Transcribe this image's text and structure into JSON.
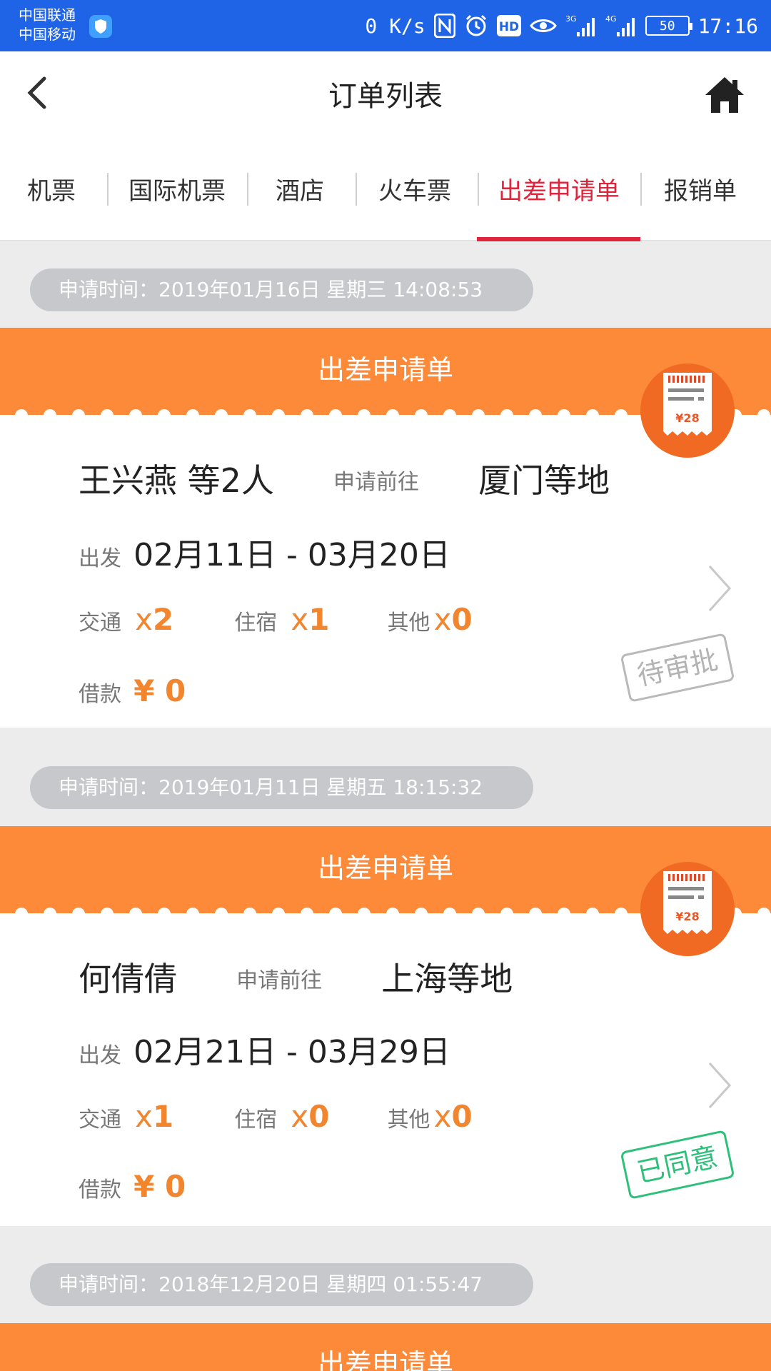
{
  "status_bar": {
    "carrier_1": "中国联通",
    "carrier_2": "中国移动",
    "net_speed": "0 K/s",
    "network_1": "3G",
    "network_2": "4G",
    "battery": "50",
    "time": "17:16"
  },
  "header": {
    "title": "订单列表",
    "back_icon": "chevron-left-icon",
    "home_icon": "home-icon"
  },
  "tabs": [
    {
      "label": "机票",
      "active": false
    },
    {
      "label": "国际机票",
      "active": false
    },
    {
      "label": "酒店",
      "active": false
    },
    {
      "label": "火车票",
      "active": false
    },
    {
      "label": "出差申请单",
      "active": true
    },
    {
      "label": "报销单",
      "active": false
    }
  ],
  "colors": {
    "accent": "#e0243b",
    "banner": "#fd8a38",
    "count": "#f2862f",
    "status_blue": "#1f63e6",
    "approved_green": "#2ec07a"
  },
  "orders": [
    {
      "apply_time": "申请时间：2019年01月16日 星期三 14:08:53",
      "banner_title": "出差申请单",
      "applicant": "王兴燕 等2人",
      "to_label": "申请前往",
      "destination": "厦门等地",
      "depart_label": "出发",
      "dates": "02月11日  - 03月20日",
      "traffic_label": "交通",
      "traffic_x": "x",
      "traffic_count": "2",
      "hotel_label": "住宿",
      "hotel_x": "x",
      "hotel_count": "1",
      "other_label": "其他",
      "other_x": "x",
      "other_count": "0",
      "loan_label": "借款",
      "loan_value": "¥ 0",
      "status": "待审批",
      "receipt_amount": "¥28"
    },
    {
      "apply_time": "申请时间：2019年01月11日 星期五 18:15:32",
      "banner_title": "出差申请单",
      "applicant": "何倩倩",
      "to_label": "申请前往",
      "destination": "上海等地",
      "depart_label": "出发",
      "dates": "02月21日  - 03月29日",
      "traffic_label": "交通",
      "traffic_x": "x",
      "traffic_count": "1",
      "hotel_label": "住宿",
      "hotel_x": "x",
      "hotel_count": "0",
      "other_label": "其他",
      "other_x": "x",
      "other_count": "0",
      "loan_label": "借款",
      "loan_value": "¥ 0",
      "status": "已同意",
      "receipt_amount": "¥28"
    },
    {
      "apply_time": "申请时间：2018年12月20日 星期四 01:55:47",
      "banner_title": "出差申请单"
    }
  ]
}
